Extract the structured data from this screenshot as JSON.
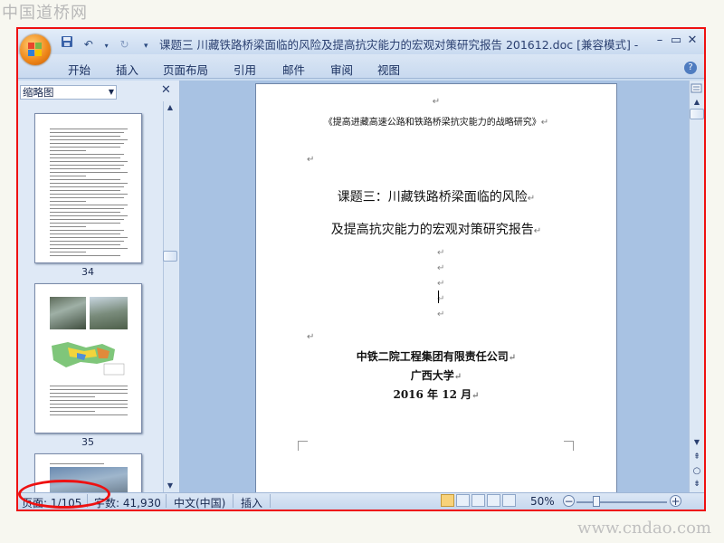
{
  "watermark": {
    "top": "中国道桥网",
    "bottom": "www.cndao.com"
  },
  "window": {
    "title": "课题三 川藏铁路桥梁面临的风险及提高抗灾能力的宏观对策研究报告 201612.doc [兼容模式] - M...",
    "controls": [
      "–",
      "▭",
      "✕"
    ]
  },
  "quick_access": {
    "icons": [
      "save-icon",
      "undo-icon",
      "redo-icon",
      "customize-icon"
    ]
  },
  "ribbon": {
    "tabs": [
      "开始",
      "插入",
      "页面布局",
      "引用",
      "邮件",
      "审阅",
      "视图"
    ],
    "help": "?"
  },
  "thumbnail_pane": {
    "dropdown_value": "缩略图",
    "close": "✕",
    "pages": [
      {
        "number": "34"
      },
      {
        "number": "35"
      }
    ]
  },
  "document": {
    "series": "《提高进藏高速公路和铁路桥梁抗灾能力的战略研究》",
    "title_line1": "课题三：川藏铁路桥梁面临的风险",
    "title_line2": "及提高抗灾能力的宏观对策研究报告",
    "org1": "中铁二院工程集团有限责任公司",
    "org2": "广西大学",
    "date": "2016 年 12 月",
    "para_mark": "↵"
  },
  "statusbar": {
    "page": "页面: 1/105",
    "words": "字数: 41,930",
    "language": "中文(中国)",
    "mode": "插入",
    "zoom": "50%",
    "zoom_level": 0.5
  },
  "colors": {
    "frame": "#ee1111",
    "ribbon": "#c9daf0",
    "doc_bg": "#a8c2e3"
  }
}
